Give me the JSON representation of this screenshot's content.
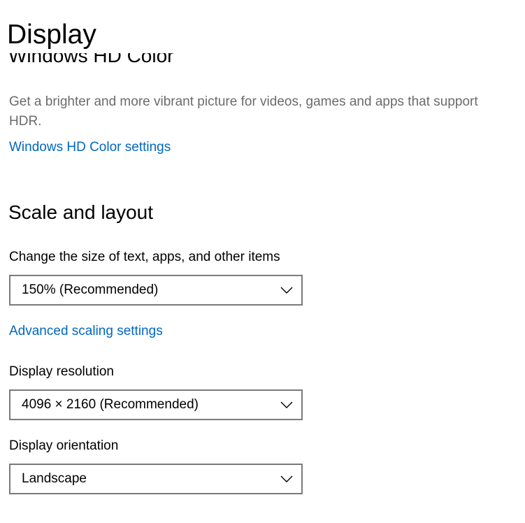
{
  "page": {
    "title": "Display"
  },
  "hdr": {
    "heading": "Windows HD Color",
    "description": "Get a brighter and more vibrant picture for videos, games and apps that support HDR.",
    "link": "Windows HD Color settings"
  },
  "scale": {
    "heading": "Scale and layout",
    "size_label": "Change the size of text, apps, and other items",
    "size_value": "150% (Recommended)",
    "advanced_link": "Advanced scaling settings",
    "resolution_label": "Display resolution",
    "resolution_value": "4096 × 2160 (Recommended)",
    "orientation_label": "Display orientation",
    "orientation_value": "Landscape"
  },
  "colors": {
    "link": "#0067c0",
    "secondary_text": "#6b6b6b",
    "dropdown_border": "#7a7a7a"
  },
  "icons": {
    "dropdown_chevron": "chevron-down-icon"
  }
}
